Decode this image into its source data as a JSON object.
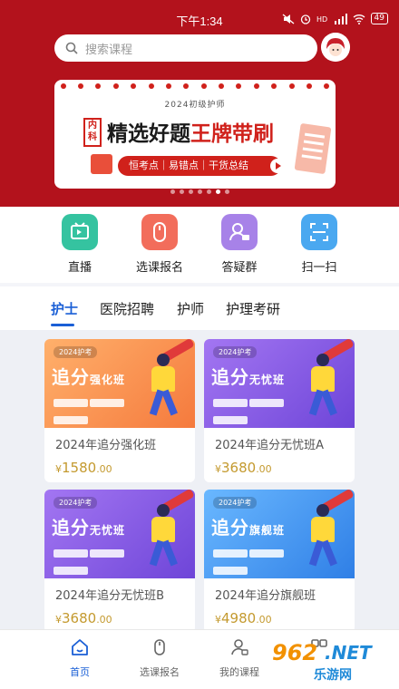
{
  "status_bar": {
    "time": "下午1:34",
    "battery": "49",
    "icons": [
      "mute-icon",
      "alarm-icon",
      "hd-icon",
      "signal-icon",
      "wifi-icon",
      "battery-icon"
    ]
  },
  "search": {
    "placeholder": "搜索课程"
  },
  "banner": {
    "year": "2024初级护师",
    "badge": "内科",
    "title_black": "精选好题",
    "title_red": "王牌带刷",
    "pill": "恒考点｜易错点｜干货总结",
    "slide_count": 7,
    "active_slide": 6
  },
  "quick_menu": [
    {
      "label": "直播",
      "icon": "tv-icon",
      "color": "#35c3a0"
    },
    {
      "label": "选课报名",
      "icon": "mouse-icon",
      "color": "#f26d5b"
    },
    {
      "label": "答疑群",
      "icon": "user-chat-icon",
      "color": "#a782e8"
    },
    {
      "label": "扫一扫",
      "icon": "scan-icon",
      "color": "#4aa8f0"
    }
  ],
  "tabs": [
    {
      "label": "护士",
      "active": true
    },
    {
      "label": "医院招聘",
      "active": false
    },
    {
      "label": "护师",
      "active": false
    },
    {
      "label": "护理考研",
      "active": false
    }
  ],
  "courses": [
    {
      "img_tag": "2024护考",
      "img_title_a": "追分",
      "img_title_b": "强化班",
      "theme": "orange",
      "title": "2024年追分强化班",
      "price_yen": "¥",
      "price_int": "1580",
      "price_dec": ".00"
    },
    {
      "img_tag": "2024护考",
      "img_title_a": "追分",
      "img_title_b": "无忧班",
      "theme": "purple",
      "title": "2024年追分无忧班A",
      "price_yen": "¥",
      "price_int": "3680",
      "price_dec": ".00"
    },
    {
      "img_tag": "2024护考",
      "img_title_a": "追分",
      "img_title_b": "无忧班",
      "theme": "purple",
      "title": "2024年追分无忧班B",
      "price_yen": "¥",
      "price_int": "3680",
      "price_dec": ".00"
    },
    {
      "img_tag": "2024护考",
      "img_title_a": "追分",
      "img_title_b": "旗舰班",
      "theme": "blue",
      "title": "2024年追分旗舰班",
      "price_yen": "¥",
      "price_int": "4980",
      "price_dec": ".00"
    }
  ],
  "bottom_nav": [
    {
      "label": "首页",
      "icon": "home-icon",
      "active": true
    },
    {
      "label": "选课报名",
      "icon": "mouse-icon",
      "active": false
    },
    {
      "label": "我的课程",
      "icon": "user-course-icon",
      "active": false
    },
    {
      "label": "",
      "icon": "grid-icon",
      "active": false
    }
  ],
  "watermark": {
    "num": "962",
    "net": ".NET",
    "cn": "乐游网"
  },
  "colors": {
    "header_red": "#b3121c",
    "accent_blue": "#1a5fd6",
    "price_gold": "#c49a2f"
  }
}
